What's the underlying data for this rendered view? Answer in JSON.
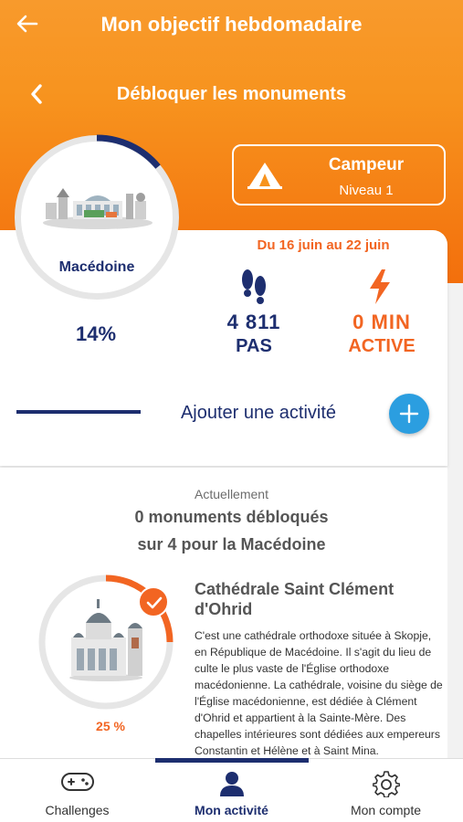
{
  "header": {
    "title": "Mon objectif hebdomadaire",
    "subtitle": "Débloquer les monuments"
  },
  "country": {
    "name": "Macédoine",
    "percent": "14%",
    "progress": 0.14
  },
  "level": {
    "name": "Campeur",
    "number": "Niveau 1"
  },
  "week": {
    "date_range": "Du 16 juin au 22 juin"
  },
  "stats": {
    "steps_value": "4 811",
    "steps_unit": "PAS",
    "active_value": "0 MIN",
    "active_unit": "ACTIVE"
  },
  "actions": {
    "add_activity": "Ajouter une activité"
  },
  "progress_section": {
    "currently": "Actuellement",
    "line1": "0 monuments débloqués",
    "line2": "sur 4 pour la Macédoine"
  },
  "monument": {
    "title": "Cathédrale Saint Clément d'Ohrid",
    "percent": "25 %",
    "progress": 0.25,
    "description": "C'est une cathédrale orthodoxe située à Skopje, en République de Macédoine. Il s'agit du lieu de culte le plus vaste de l'Église orthodoxe macédonienne. La cathédrale, voisine du siège de l'Église macédonienne, est dédiée à Clément d'Ohrid et appartient à la Sainte-Mère. Des chapelles intérieures sont dédiées aux empereurs Constantin et Hélène et à Saint Mina."
  },
  "nav": {
    "items": [
      {
        "label": "Challenges",
        "icon": "gamepad-icon"
      },
      {
        "label": "Mon activité",
        "icon": "user-icon",
        "active": true
      },
      {
        "label": "Mon compte",
        "icon": "gear-icon"
      }
    ]
  },
  "colors": {
    "orange": "#f26522",
    "navy": "#1d2e6f",
    "blue": "#2b9ee0"
  }
}
